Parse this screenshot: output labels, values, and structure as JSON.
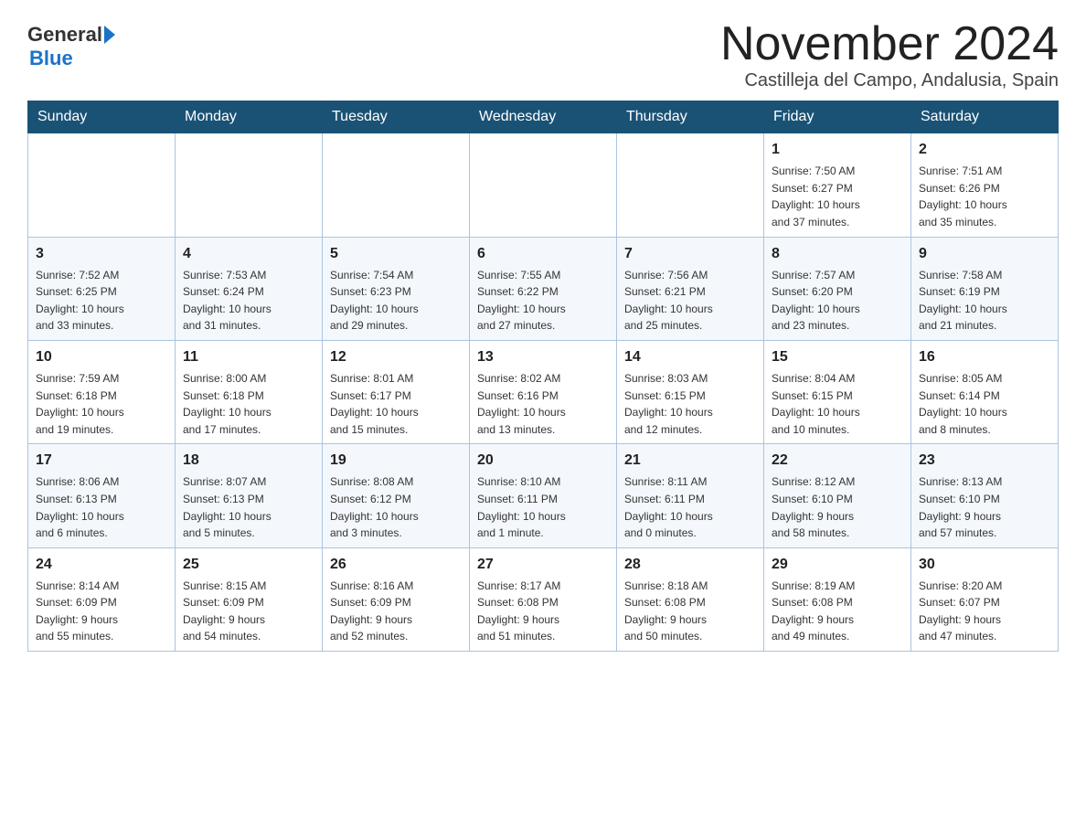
{
  "header": {
    "logo_general": "General",
    "logo_blue": "Blue",
    "month_title": "November 2024",
    "subtitle": "Castilleja del Campo, Andalusia, Spain"
  },
  "days_of_week": [
    "Sunday",
    "Monday",
    "Tuesday",
    "Wednesday",
    "Thursday",
    "Friday",
    "Saturday"
  ],
  "weeks": [
    {
      "days": [
        {
          "number": "",
          "info": ""
        },
        {
          "number": "",
          "info": ""
        },
        {
          "number": "",
          "info": ""
        },
        {
          "number": "",
          "info": ""
        },
        {
          "number": "",
          "info": ""
        },
        {
          "number": "1",
          "info": "Sunrise: 7:50 AM\nSunset: 6:27 PM\nDaylight: 10 hours\nand 37 minutes."
        },
        {
          "number": "2",
          "info": "Sunrise: 7:51 AM\nSunset: 6:26 PM\nDaylight: 10 hours\nand 35 minutes."
        }
      ]
    },
    {
      "days": [
        {
          "number": "3",
          "info": "Sunrise: 7:52 AM\nSunset: 6:25 PM\nDaylight: 10 hours\nand 33 minutes."
        },
        {
          "number": "4",
          "info": "Sunrise: 7:53 AM\nSunset: 6:24 PM\nDaylight: 10 hours\nand 31 minutes."
        },
        {
          "number": "5",
          "info": "Sunrise: 7:54 AM\nSunset: 6:23 PM\nDaylight: 10 hours\nand 29 minutes."
        },
        {
          "number": "6",
          "info": "Sunrise: 7:55 AM\nSunset: 6:22 PM\nDaylight: 10 hours\nand 27 minutes."
        },
        {
          "number": "7",
          "info": "Sunrise: 7:56 AM\nSunset: 6:21 PM\nDaylight: 10 hours\nand 25 minutes."
        },
        {
          "number": "8",
          "info": "Sunrise: 7:57 AM\nSunset: 6:20 PM\nDaylight: 10 hours\nand 23 minutes."
        },
        {
          "number": "9",
          "info": "Sunrise: 7:58 AM\nSunset: 6:19 PM\nDaylight: 10 hours\nand 21 minutes."
        }
      ]
    },
    {
      "days": [
        {
          "number": "10",
          "info": "Sunrise: 7:59 AM\nSunset: 6:18 PM\nDaylight: 10 hours\nand 19 minutes."
        },
        {
          "number": "11",
          "info": "Sunrise: 8:00 AM\nSunset: 6:18 PM\nDaylight: 10 hours\nand 17 minutes."
        },
        {
          "number": "12",
          "info": "Sunrise: 8:01 AM\nSunset: 6:17 PM\nDaylight: 10 hours\nand 15 minutes."
        },
        {
          "number": "13",
          "info": "Sunrise: 8:02 AM\nSunset: 6:16 PM\nDaylight: 10 hours\nand 13 minutes."
        },
        {
          "number": "14",
          "info": "Sunrise: 8:03 AM\nSunset: 6:15 PM\nDaylight: 10 hours\nand 12 minutes."
        },
        {
          "number": "15",
          "info": "Sunrise: 8:04 AM\nSunset: 6:15 PM\nDaylight: 10 hours\nand 10 minutes."
        },
        {
          "number": "16",
          "info": "Sunrise: 8:05 AM\nSunset: 6:14 PM\nDaylight: 10 hours\nand 8 minutes."
        }
      ]
    },
    {
      "days": [
        {
          "number": "17",
          "info": "Sunrise: 8:06 AM\nSunset: 6:13 PM\nDaylight: 10 hours\nand 6 minutes."
        },
        {
          "number": "18",
          "info": "Sunrise: 8:07 AM\nSunset: 6:13 PM\nDaylight: 10 hours\nand 5 minutes."
        },
        {
          "number": "19",
          "info": "Sunrise: 8:08 AM\nSunset: 6:12 PM\nDaylight: 10 hours\nand 3 minutes."
        },
        {
          "number": "20",
          "info": "Sunrise: 8:10 AM\nSunset: 6:11 PM\nDaylight: 10 hours\nand 1 minute."
        },
        {
          "number": "21",
          "info": "Sunrise: 8:11 AM\nSunset: 6:11 PM\nDaylight: 10 hours\nand 0 minutes."
        },
        {
          "number": "22",
          "info": "Sunrise: 8:12 AM\nSunset: 6:10 PM\nDaylight: 9 hours\nand 58 minutes."
        },
        {
          "number": "23",
          "info": "Sunrise: 8:13 AM\nSunset: 6:10 PM\nDaylight: 9 hours\nand 57 minutes."
        }
      ]
    },
    {
      "days": [
        {
          "number": "24",
          "info": "Sunrise: 8:14 AM\nSunset: 6:09 PM\nDaylight: 9 hours\nand 55 minutes."
        },
        {
          "number": "25",
          "info": "Sunrise: 8:15 AM\nSunset: 6:09 PM\nDaylight: 9 hours\nand 54 minutes."
        },
        {
          "number": "26",
          "info": "Sunrise: 8:16 AM\nSunset: 6:09 PM\nDaylight: 9 hours\nand 52 minutes."
        },
        {
          "number": "27",
          "info": "Sunrise: 8:17 AM\nSunset: 6:08 PM\nDaylight: 9 hours\nand 51 minutes."
        },
        {
          "number": "28",
          "info": "Sunrise: 8:18 AM\nSunset: 6:08 PM\nDaylight: 9 hours\nand 50 minutes."
        },
        {
          "number": "29",
          "info": "Sunrise: 8:19 AM\nSunset: 6:08 PM\nDaylight: 9 hours\nand 49 minutes."
        },
        {
          "number": "30",
          "info": "Sunrise: 8:20 AM\nSunset: 6:07 PM\nDaylight: 9 hours\nand 47 minutes."
        }
      ]
    }
  ]
}
